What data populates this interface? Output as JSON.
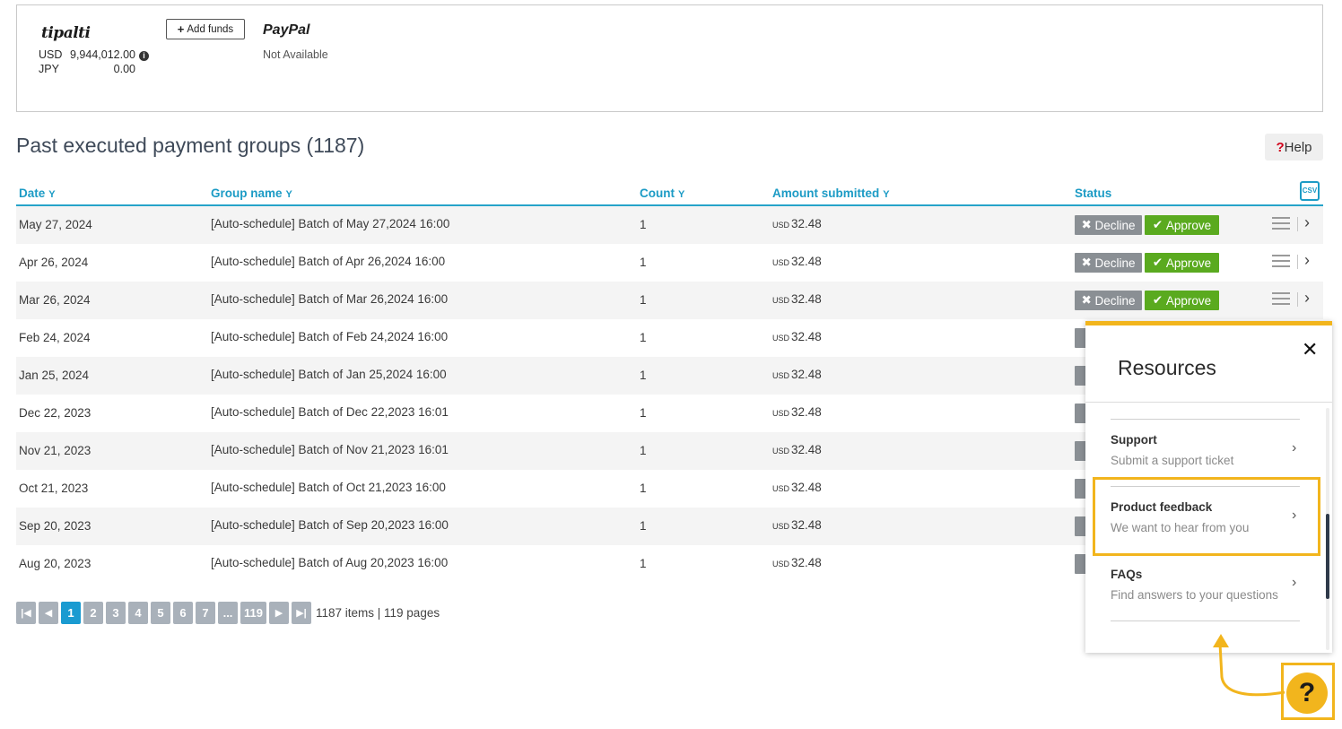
{
  "funding": {
    "tipalti_logo": "tipalti",
    "balances": [
      {
        "currency": "USD",
        "amount": "9,944,012.00",
        "has_info": true
      },
      {
        "currency": "JPY",
        "amount": "0.00",
        "has_info": false
      }
    ],
    "add_funds_label": "Add funds",
    "paypal_logo": "PayPal",
    "paypal_status": "Not Available"
  },
  "section": {
    "title": "Past executed payment groups (1187)",
    "help_label": "Help"
  },
  "table": {
    "headers": {
      "date": "Date",
      "group_name": "Group name",
      "count": "Count",
      "amount": "Amount submitted",
      "status": "Status"
    },
    "csv_label": "CSV",
    "decline_label": "Decline",
    "approve_label": "Approve",
    "currency_label": "USD",
    "rows": [
      {
        "date": "May 27, 2024",
        "name": "[Auto-schedule] Batch of May 27,2024 16:00",
        "count": "1",
        "amount": "32.48"
      },
      {
        "date": "Apr 26, 2024",
        "name": "[Auto-schedule] Batch of Apr 26,2024 16:00",
        "count": "1",
        "amount": "32.48"
      },
      {
        "date": "Mar 26, 2024",
        "name": "[Auto-schedule] Batch of Mar 26,2024 16:00",
        "count": "1",
        "amount": "32.48"
      },
      {
        "date": "Feb 24, 2024",
        "name": "[Auto-schedule] Batch of Feb 24,2024 16:00",
        "count": "1",
        "amount": "32.48"
      },
      {
        "date": "Jan 25, 2024",
        "name": "[Auto-schedule] Batch of Jan 25,2024 16:00",
        "count": "1",
        "amount": "32.48"
      },
      {
        "date": "Dec 22, 2023",
        "name": "[Auto-schedule] Batch of Dec 22,2023 16:01",
        "count": "1",
        "amount": "32.48"
      },
      {
        "date": "Nov 21, 2023",
        "name": "[Auto-schedule] Batch of Nov 21,2023 16:01",
        "count": "1",
        "amount": "32.48"
      },
      {
        "date": "Oct 21, 2023",
        "name": "[Auto-schedule] Batch of Oct 21,2023 16:00",
        "count": "1",
        "amount": "32.48"
      },
      {
        "date": "Sep 20, 2023",
        "name": "[Auto-schedule] Batch of Sep 20,2023 16:00",
        "count": "1",
        "amount": "32.48"
      },
      {
        "date": "Aug 20, 2023",
        "name": "[Auto-schedule] Batch of Aug 20,2023 16:00",
        "count": "1",
        "amount": "32.48"
      }
    ]
  },
  "pagination": {
    "pages": [
      "1",
      "2",
      "3",
      "4",
      "5",
      "6",
      "7",
      "...",
      "119"
    ],
    "active_page": "1",
    "info": "1187 items | 119 pages"
  },
  "resources": {
    "title": "Resources",
    "items": [
      {
        "title": "Support",
        "subtitle": "Submit a support ticket"
      },
      {
        "title": "Product feedback",
        "subtitle": "We want to hear from you"
      },
      {
        "title": "FAQs",
        "subtitle": "Find answers to your questions"
      }
    ],
    "highlighted_item": "Product feedback"
  },
  "help_fab_label": "?",
  "colors": {
    "accent": "#1c9bc5",
    "approve": "#5aaa1f",
    "decline": "#8a8f94",
    "highlight": "#f2b51d"
  }
}
